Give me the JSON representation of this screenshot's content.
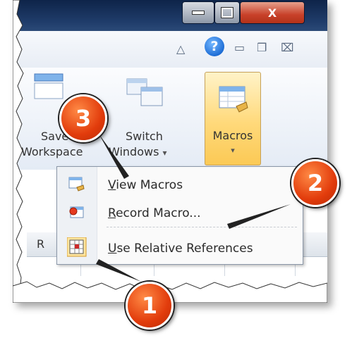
{
  "ribbon": {
    "save_workspace_line1": "Save",
    "save_workspace_line2": "Workspace",
    "switch_windows_line1": "Switch",
    "switch_windows_line2": "Windows",
    "switch_windows_arrow": "▾",
    "macros_label": "Macros",
    "macros_arrow": "▾",
    "help_glyph": "?",
    "close_glyph": "X"
  },
  "sheet": {
    "column_r": "R"
  },
  "macros_menu": {
    "items": [
      {
        "label": "View Macros",
        "icon": "view-macros-icon"
      },
      {
        "label": "Record Macro...",
        "icon": "record-macro-icon"
      },
      {
        "label": "Use Relative References",
        "icon": "relative-references-icon"
      }
    ]
  },
  "callouts": {
    "one": "1",
    "two": "2",
    "three": "3"
  },
  "colors": {
    "callout": "#e23c0c",
    "highlight": "#ffd97a",
    "titlebar": "#1f3c6a"
  }
}
